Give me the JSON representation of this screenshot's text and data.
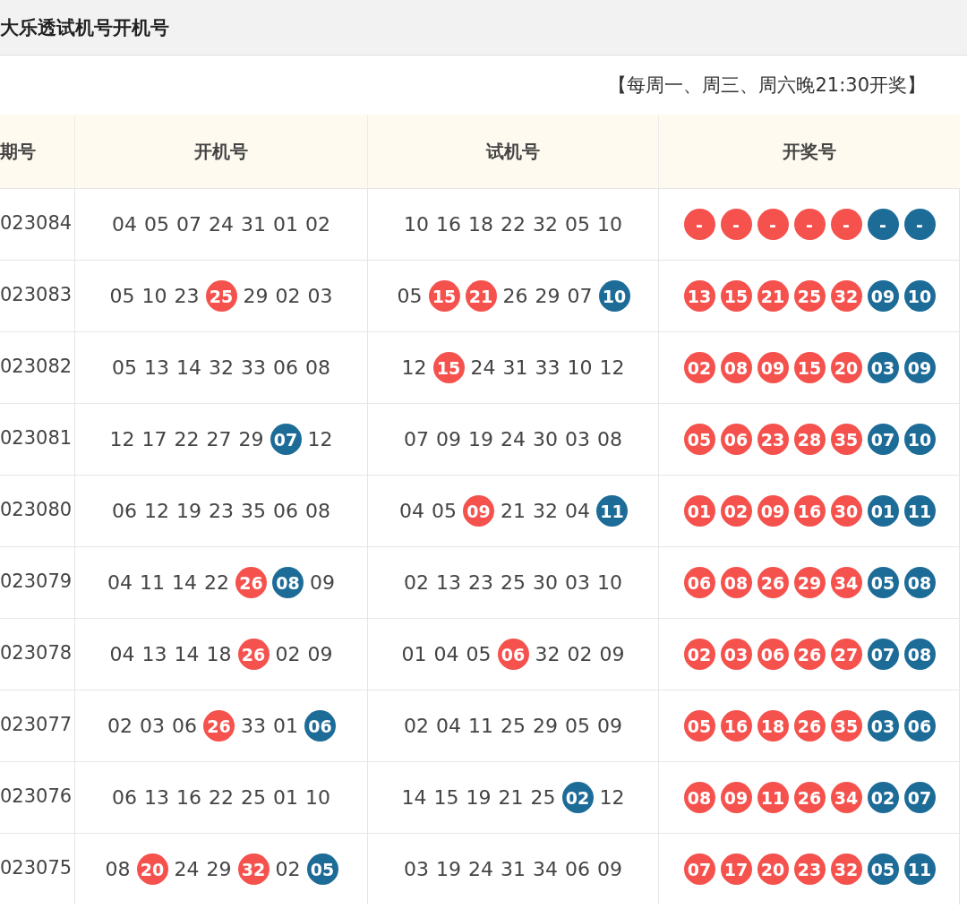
{
  "title": "大乐透试机号开机号",
  "note": "【每周一、周三、周六晚21:30开奖】",
  "columns": [
    "期号",
    "开机号",
    "试机号",
    "开奖号"
  ],
  "rows": [
    {
      "period": "023084",
      "open": [
        {
          "n": "04",
          "kind": "plain"
        },
        {
          "n": "05",
          "kind": "plain"
        },
        {
          "n": "07",
          "kind": "plain"
        },
        {
          "n": "24",
          "kind": "plain"
        },
        {
          "n": "31",
          "kind": "plain"
        },
        {
          "n": "01",
          "kind": "plain"
        },
        {
          "n": "02",
          "kind": "plain"
        }
      ],
      "test": [
        {
          "n": "10",
          "kind": "plain"
        },
        {
          "n": "16",
          "kind": "plain"
        },
        {
          "n": "18",
          "kind": "plain"
        },
        {
          "n": "22",
          "kind": "plain"
        },
        {
          "n": "32",
          "kind": "plain"
        },
        {
          "n": "05",
          "kind": "plain"
        },
        {
          "n": "10",
          "kind": "plain"
        }
      ],
      "draw": [
        {
          "n": "-",
          "kind": "front"
        },
        {
          "n": "-",
          "kind": "front"
        },
        {
          "n": "-",
          "kind": "front"
        },
        {
          "n": "-",
          "kind": "front"
        },
        {
          "n": "-",
          "kind": "front"
        },
        {
          "n": "-",
          "kind": "back"
        },
        {
          "n": "-",
          "kind": "back"
        }
      ]
    },
    {
      "period": "023083",
      "open": [
        {
          "n": "05",
          "kind": "plain"
        },
        {
          "n": "10",
          "kind": "plain"
        },
        {
          "n": "23",
          "kind": "plain"
        },
        {
          "n": "25",
          "kind": "front"
        },
        {
          "n": "29",
          "kind": "plain"
        },
        {
          "n": "02",
          "kind": "plain"
        },
        {
          "n": "03",
          "kind": "plain"
        }
      ],
      "test": [
        {
          "n": "05",
          "kind": "plain"
        },
        {
          "n": "15",
          "kind": "front"
        },
        {
          "n": "21",
          "kind": "front"
        },
        {
          "n": "26",
          "kind": "plain"
        },
        {
          "n": "29",
          "kind": "plain"
        },
        {
          "n": "07",
          "kind": "plain"
        },
        {
          "n": "10",
          "kind": "back"
        }
      ],
      "draw": [
        {
          "n": "13",
          "kind": "front"
        },
        {
          "n": "15",
          "kind": "front"
        },
        {
          "n": "21",
          "kind": "front"
        },
        {
          "n": "25",
          "kind": "front"
        },
        {
          "n": "32",
          "kind": "front"
        },
        {
          "n": "09",
          "kind": "back"
        },
        {
          "n": "10",
          "kind": "back"
        }
      ]
    },
    {
      "period": "023082",
      "open": [
        {
          "n": "05",
          "kind": "plain"
        },
        {
          "n": "13",
          "kind": "plain"
        },
        {
          "n": "14",
          "kind": "plain"
        },
        {
          "n": "32",
          "kind": "plain"
        },
        {
          "n": "33",
          "kind": "plain"
        },
        {
          "n": "06",
          "kind": "plain"
        },
        {
          "n": "08",
          "kind": "plain"
        }
      ],
      "test": [
        {
          "n": "12",
          "kind": "plain"
        },
        {
          "n": "15",
          "kind": "front"
        },
        {
          "n": "24",
          "kind": "plain"
        },
        {
          "n": "31",
          "kind": "plain"
        },
        {
          "n": "33",
          "kind": "plain"
        },
        {
          "n": "10",
          "kind": "plain"
        },
        {
          "n": "12",
          "kind": "plain"
        }
      ],
      "draw": [
        {
          "n": "02",
          "kind": "front"
        },
        {
          "n": "08",
          "kind": "front"
        },
        {
          "n": "09",
          "kind": "front"
        },
        {
          "n": "15",
          "kind": "front"
        },
        {
          "n": "20",
          "kind": "front"
        },
        {
          "n": "03",
          "kind": "back"
        },
        {
          "n": "09",
          "kind": "back"
        }
      ]
    },
    {
      "period": "023081",
      "open": [
        {
          "n": "12",
          "kind": "plain"
        },
        {
          "n": "17",
          "kind": "plain"
        },
        {
          "n": "22",
          "kind": "plain"
        },
        {
          "n": "27",
          "kind": "plain"
        },
        {
          "n": "29",
          "kind": "plain"
        },
        {
          "n": "07",
          "kind": "back"
        },
        {
          "n": "12",
          "kind": "plain"
        }
      ],
      "test": [
        {
          "n": "07",
          "kind": "plain"
        },
        {
          "n": "09",
          "kind": "plain"
        },
        {
          "n": "19",
          "kind": "plain"
        },
        {
          "n": "24",
          "kind": "plain"
        },
        {
          "n": "30",
          "kind": "plain"
        },
        {
          "n": "03",
          "kind": "plain"
        },
        {
          "n": "08",
          "kind": "plain"
        }
      ],
      "draw": [
        {
          "n": "05",
          "kind": "front"
        },
        {
          "n": "06",
          "kind": "front"
        },
        {
          "n": "23",
          "kind": "front"
        },
        {
          "n": "28",
          "kind": "front"
        },
        {
          "n": "35",
          "kind": "front"
        },
        {
          "n": "07",
          "kind": "back"
        },
        {
          "n": "10",
          "kind": "back"
        }
      ]
    },
    {
      "period": "023080",
      "open": [
        {
          "n": "06",
          "kind": "plain"
        },
        {
          "n": "12",
          "kind": "plain"
        },
        {
          "n": "19",
          "kind": "plain"
        },
        {
          "n": "23",
          "kind": "plain"
        },
        {
          "n": "35",
          "kind": "plain"
        },
        {
          "n": "06",
          "kind": "plain"
        },
        {
          "n": "08",
          "kind": "plain"
        }
      ],
      "test": [
        {
          "n": "04",
          "kind": "plain"
        },
        {
          "n": "05",
          "kind": "plain"
        },
        {
          "n": "09",
          "kind": "front"
        },
        {
          "n": "21",
          "kind": "plain"
        },
        {
          "n": "32",
          "kind": "plain"
        },
        {
          "n": "04",
          "kind": "plain"
        },
        {
          "n": "11",
          "kind": "back"
        }
      ],
      "draw": [
        {
          "n": "01",
          "kind": "front"
        },
        {
          "n": "02",
          "kind": "front"
        },
        {
          "n": "09",
          "kind": "front"
        },
        {
          "n": "16",
          "kind": "front"
        },
        {
          "n": "30",
          "kind": "front"
        },
        {
          "n": "01",
          "kind": "back"
        },
        {
          "n": "11",
          "kind": "back"
        }
      ]
    },
    {
      "period": "023079",
      "open": [
        {
          "n": "04",
          "kind": "plain"
        },
        {
          "n": "11",
          "kind": "plain"
        },
        {
          "n": "14",
          "kind": "plain"
        },
        {
          "n": "22",
          "kind": "plain"
        },
        {
          "n": "26",
          "kind": "front"
        },
        {
          "n": "08",
          "kind": "back"
        },
        {
          "n": "09",
          "kind": "plain"
        }
      ],
      "test": [
        {
          "n": "02",
          "kind": "plain"
        },
        {
          "n": "13",
          "kind": "plain"
        },
        {
          "n": "23",
          "kind": "plain"
        },
        {
          "n": "25",
          "kind": "plain"
        },
        {
          "n": "30",
          "kind": "plain"
        },
        {
          "n": "03",
          "kind": "plain"
        },
        {
          "n": "10",
          "kind": "plain"
        }
      ],
      "draw": [
        {
          "n": "06",
          "kind": "front"
        },
        {
          "n": "08",
          "kind": "front"
        },
        {
          "n": "26",
          "kind": "front"
        },
        {
          "n": "29",
          "kind": "front"
        },
        {
          "n": "34",
          "kind": "front"
        },
        {
          "n": "05",
          "kind": "back"
        },
        {
          "n": "08",
          "kind": "back"
        }
      ]
    },
    {
      "period": "023078",
      "open": [
        {
          "n": "04",
          "kind": "plain"
        },
        {
          "n": "13",
          "kind": "plain"
        },
        {
          "n": "14",
          "kind": "plain"
        },
        {
          "n": "18",
          "kind": "plain"
        },
        {
          "n": "26",
          "kind": "front"
        },
        {
          "n": "02",
          "kind": "plain"
        },
        {
          "n": "09",
          "kind": "plain"
        }
      ],
      "test": [
        {
          "n": "01",
          "kind": "plain"
        },
        {
          "n": "04",
          "kind": "plain"
        },
        {
          "n": "05",
          "kind": "plain"
        },
        {
          "n": "06",
          "kind": "front"
        },
        {
          "n": "32",
          "kind": "plain"
        },
        {
          "n": "02",
          "kind": "plain"
        },
        {
          "n": "09",
          "kind": "plain"
        }
      ],
      "draw": [
        {
          "n": "02",
          "kind": "front"
        },
        {
          "n": "03",
          "kind": "front"
        },
        {
          "n": "06",
          "kind": "front"
        },
        {
          "n": "26",
          "kind": "front"
        },
        {
          "n": "27",
          "kind": "front"
        },
        {
          "n": "07",
          "kind": "back"
        },
        {
          "n": "08",
          "kind": "back"
        }
      ]
    },
    {
      "period": "023077",
      "open": [
        {
          "n": "02",
          "kind": "plain"
        },
        {
          "n": "03",
          "kind": "plain"
        },
        {
          "n": "06",
          "kind": "plain"
        },
        {
          "n": "26",
          "kind": "front"
        },
        {
          "n": "33",
          "kind": "plain"
        },
        {
          "n": "01",
          "kind": "plain"
        },
        {
          "n": "06",
          "kind": "back"
        }
      ],
      "test": [
        {
          "n": "02",
          "kind": "plain"
        },
        {
          "n": "04",
          "kind": "plain"
        },
        {
          "n": "11",
          "kind": "plain"
        },
        {
          "n": "25",
          "kind": "plain"
        },
        {
          "n": "29",
          "kind": "plain"
        },
        {
          "n": "05",
          "kind": "plain"
        },
        {
          "n": "09",
          "kind": "plain"
        }
      ],
      "draw": [
        {
          "n": "05",
          "kind": "front"
        },
        {
          "n": "16",
          "kind": "front"
        },
        {
          "n": "18",
          "kind": "front"
        },
        {
          "n": "26",
          "kind": "front"
        },
        {
          "n": "35",
          "kind": "front"
        },
        {
          "n": "03",
          "kind": "back"
        },
        {
          "n": "06",
          "kind": "back"
        }
      ]
    },
    {
      "period": "023076",
      "open": [
        {
          "n": "06",
          "kind": "plain"
        },
        {
          "n": "13",
          "kind": "plain"
        },
        {
          "n": "16",
          "kind": "plain"
        },
        {
          "n": "22",
          "kind": "plain"
        },
        {
          "n": "25",
          "kind": "plain"
        },
        {
          "n": "01",
          "kind": "plain"
        },
        {
          "n": "10",
          "kind": "plain"
        }
      ],
      "test": [
        {
          "n": "14",
          "kind": "plain"
        },
        {
          "n": "15",
          "kind": "plain"
        },
        {
          "n": "19",
          "kind": "plain"
        },
        {
          "n": "21",
          "kind": "plain"
        },
        {
          "n": "25",
          "kind": "plain"
        },
        {
          "n": "02",
          "kind": "back"
        },
        {
          "n": "12",
          "kind": "plain"
        }
      ],
      "draw": [
        {
          "n": "08",
          "kind": "front"
        },
        {
          "n": "09",
          "kind": "front"
        },
        {
          "n": "11",
          "kind": "front"
        },
        {
          "n": "26",
          "kind": "front"
        },
        {
          "n": "34",
          "kind": "front"
        },
        {
          "n": "02",
          "kind": "back"
        },
        {
          "n": "07",
          "kind": "back"
        }
      ]
    },
    {
      "period": "023075",
      "open": [
        {
          "n": "08",
          "kind": "plain"
        },
        {
          "n": "20",
          "kind": "front"
        },
        {
          "n": "24",
          "kind": "plain"
        },
        {
          "n": "29",
          "kind": "plain"
        },
        {
          "n": "32",
          "kind": "front"
        },
        {
          "n": "02",
          "kind": "plain"
        },
        {
          "n": "05",
          "kind": "back"
        }
      ],
      "test": [
        {
          "n": "03",
          "kind": "plain"
        },
        {
          "n": "19",
          "kind": "plain"
        },
        {
          "n": "24",
          "kind": "plain"
        },
        {
          "n": "31",
          "kind": "plain"
        },
        {
          "n": "34",
          "kind": "plain"
        },
        {
          "n": "06",
          "kind": "plain"
        },
        {
          "n": "09",
          "kind": "plain"
        }
      ],
      "draw": [
        {
          "n": "07",
          "kind": "front"
        },
        {
          "n": "17",
          "kind": "front"
        },
        {
          "n": "20",
          "kind": "front"
        },
        {
          "n": "23",
          "kind": "front"
        },
        {
          "n": "32",
          "kind": "front"
        },
        {
          "n": "05",
          "kind": "back"
        },
        {
          "n": "11",
          "kind": "back"
        }
      ]
    }
  ]
}
